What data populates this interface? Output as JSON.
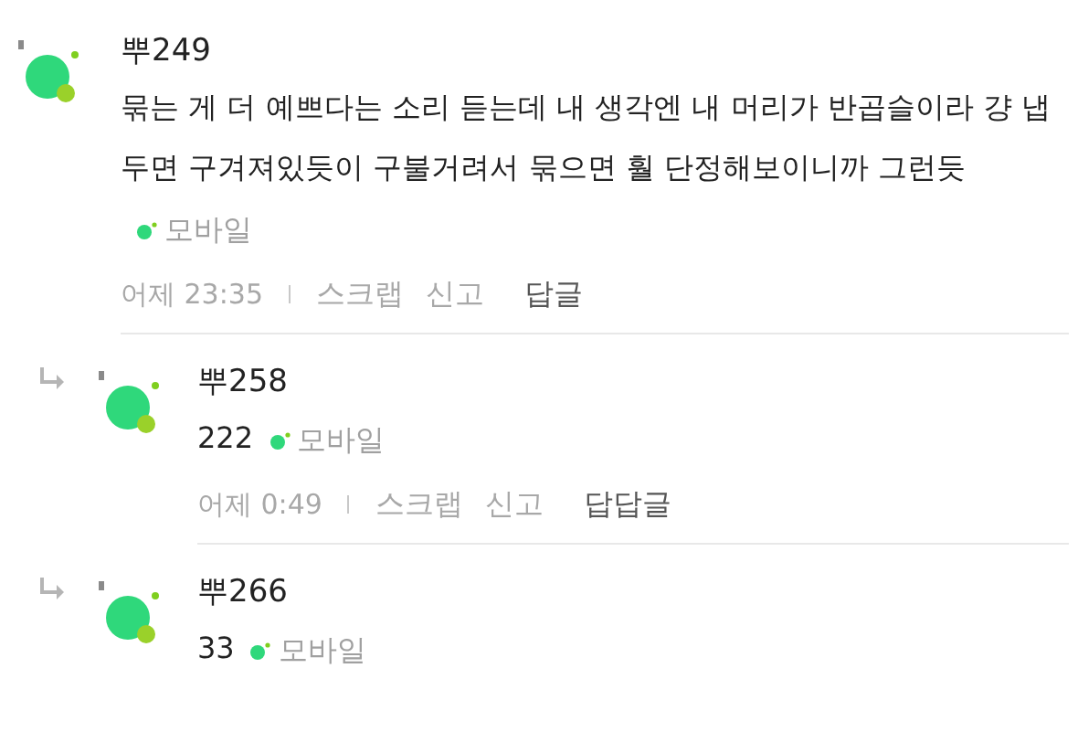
{
  "comments": [
    {
      "author": "뿌249",
      "text": "묶는 게 더 예쁘다는 소리 듣는데 내 생각엔 내 머리가 반곱슬이라 걍 냅두면 구겨져있듯이 구불거려서 묶으면 훨 단정해보이니까 그런듯",
      "device": "모바일",
      "footer": {
        "time": "어제 23:35",
        "actions": [
          "스크랩",
          "신고"
        ],
        "reply": "답글"
      },
      "children": [
        {
          "author": "뿌258",
          "text": "222",
          "device": "모바일",
          "footer": {
            "time": "어제 0:49",
            "actions": [
              "스크랩",
              "신고"
            ],
            "reply": "답답글"
          }
        },
        {
          "author": "뿌266",
          "text": "33",
          "device": "모바일"
        }
      ]
    }
  ]
}
